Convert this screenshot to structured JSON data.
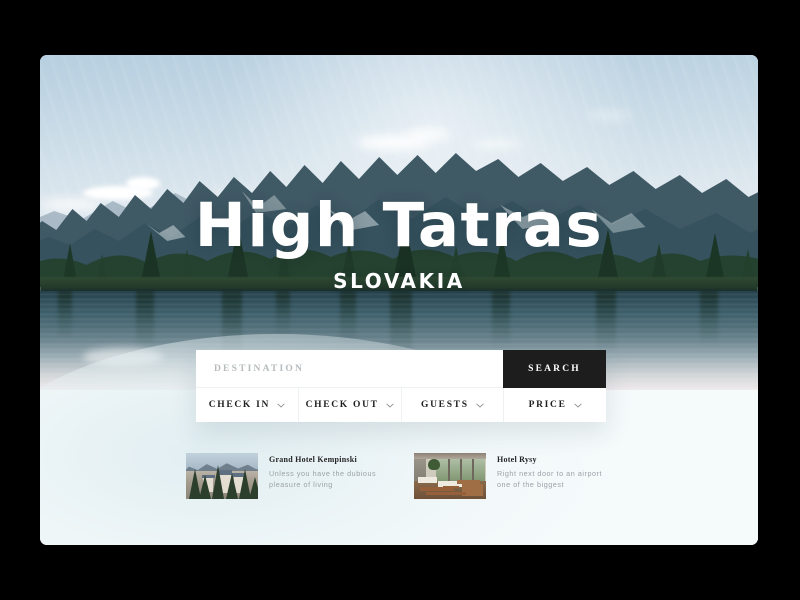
{
  "hero": {
    "title": "High Tatras",
    "subtitle": "SLOVAKIA",
    "scene_description": "Mountain lake with jagged peaks and conifer forest reflected in still water"
  },
  "search": {
    "destination_placeholder": "DESTINATION",
    "destination_value": "",
    "search_label": "SEARCH",
    "filters": [
      {
        "label": "CHECK IN",
        "icon": "chevron-down-icon"
      },
      {
        "label": "CHECK OUT",
        "icon": "chevron-down-icon"
      },
      {
        "label": "GUESTS",
        "icon": "chevron-down-icon"
      },
      {
        "label": "PRICE",
        "icon": "chevron-down-icon"
      }
    ]
  },
  "results": [
    {
      "title": "Grand Hotel Kempinski",
      "description": "Unless you have the dubious pleasure of living",
      "thumb_alt": "mountain-town-hotel-photo"
    },
    {
      "title": "Hotel Rysy",
      "description": "Right next door to an airport one of the biggest",
      "thumb_alt": "restaurant-interior-photo"
    }
  ],
  "colors": {
    "page_background": "#000000",
    "card_background": "#f5fafb",
    "panel_background": "#ffffff",
    "search_button": "#1d1d1d",
    "hero_text": "#ffffff",
    "muted_text": "#9aa2a6",
    "divider": "#eef1f2"
  }
}
